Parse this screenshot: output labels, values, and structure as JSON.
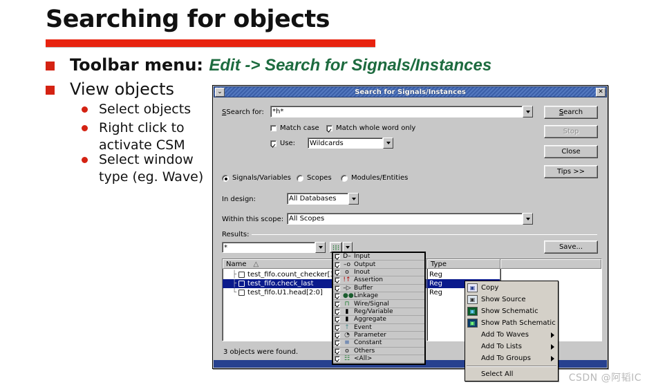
{
  "slide": {
    "title": "Searching for objects",
    "accent_color": "#e8230f",
    "bullets": [
      {
        "label": "Toolbar menu",
        "separator": ":",
        "emphasis": "Edit -> Search for Signals/Instances"
      },
      {
        "label": "View objects"
      }
    ],
    "sub_bullets": [
      "Select objects",
      "Right click to\nactivate CSM",
      "Select window\ntype (eg. Wave)"
    ]
  },
  "dialog": {
    "title": "Search for Signals/Instances",
    "menu_icon": "chevron-down-icon",
    "close_icon": "close-icon",
    "search_for_label": "Search for:",
    "search_for_value": "*h*",
    "checkboxes": [
      {
        "label": "Match case",
        "checked": false
      },
      {
        "label": "Match whole word only",
        "checked": true
      },
      {
        "label": "Use:",
        "checked": true
      }
    ],
    "use_value": "Wildcards",
    "radios": [
      {
        "label": "Signals/Variables",
        "selected": true
      },
      {
        "label": "Scopes",
        "selected": false
      },
      {
        "label": "Modules/Entities",
        "selected": false
      }
    ],
    "in_design_label": "In design:",
    "in_design_value": "All Databases",
    "within_scope_label": "Within this scope:",
    "within_scope_value": "All Scopes",
    "results_label": "Results:",
    "results_filter_value": "*",
    "buttons": {
      "search": "Search",
      "stop": "Stop",
      "close": "Close",
      "tips": "Tips >>",
      "save": "Save..."
    },
    "columns": {
      "name": "Name",
      "type": "Type"
    },
    "rows": [
      {
        "name": "test_fifo.count_checker[3...",
        "type": "Reg",
        "selected": false
      },
      {
        "name": "test_fifo.check_last",
        "type": "Reg",
        "selected": true
      },
      {
        "name": "test_fifo.U1.head[2:0]",
        "type": "Reg",
        "selected": false
      }
    ],
    "status": "3 objects were found."
  },
  "filter_menu": {
    "items": [
      {
        "label": "Input",
        "checked": true,
        "icon": "input-port-icon",
        "glyph": "D–"
      },
      {
        "label": "Output",
        "checked": true,
        "icon": "output-port-icon",
        "glyph": "–o"
      },
      {
        "label": "Inout",
        "checked": true,
        "icon": "inout-port-icon",
        "glyph": "o"
      },
      {
        "label": "Assertion",
        "checked": true,
        "icon": "assertion-icon",
        "glyph": "!↑"
      },
      {
        "label": "Buffer",
        "checked": true,
        "icon": "buffer-icon",
        "glyph": "–▷"
      },
      {
        "label": "Linkage",
        "checked": true,
        "icon": "linkage-icon",
        "glyph": "●●"
      },
      {
        "label": "Wire/Signal",
        "checked": true,
        "icon": "wire-signal-icon",
        "glyph": "⊓"
      },
      {
        "label": "Reg/Variable",
        "checked": true,
        "icon": "reg-variable-icon",
        "glyph": "▮"
      },
      {
        "label": "Aggregate",
        "checked": true,
        "icon": "aggregate-icon",
        "glyph": "▮"
      },
      {
        "label": "Event",
        "checked": true,
        "icon": "event-icon",
        "glyph": "↑"
      },
      {
        "label": "Parameter",
        "checked": true,
        "icon": "parameter-icon",
        "glyph": "◔"
      },
      {
        "label": "Constant",
        "checked": true,
        "icon": "constant-icon",
        "glyph": "≡"
      },
      {
        "label": "Others",
        "checked": true,
        "icon": "others-icon",
        "glyph": "o"
      },
      {
        "label": "<All>",
        "checked": true,
        "icon": "all-icon",
        "glyph": "☷"
      }
    ]
  },
  "context_menu": {
    "items": [
      {
        "label": "Copy",
        "icon": "copy-icon",
        "submenu": false
      },
      {
        "label": "Show Source",
        "icon": "show-source-icon",
        "submenu": false
      },
      {
        "label": "Show Schematic",
        "icon": "show-schematic-icon",
        "submenu": false
      },
      {
        "label": "Show Path Schematic",
        "icon": "show-path-schematic-icon",
        "submenu": false
      },
      {
        "label": "Add To Waves",
        "icon": "",
        "submenu": true
      },
      {
        "label": "Add To Lists",
        "icon": "",
        "submenu": true
      },
      {
        "label": "Add To Groups",
        "icon": "",
        "submenu": true
      }
    ],
    "footer_item": {
      "label": "Select All",
      "icon": "",
      "submenu": false
    }
  },
  "watermark": "CSDN @阿韬IC"
}
